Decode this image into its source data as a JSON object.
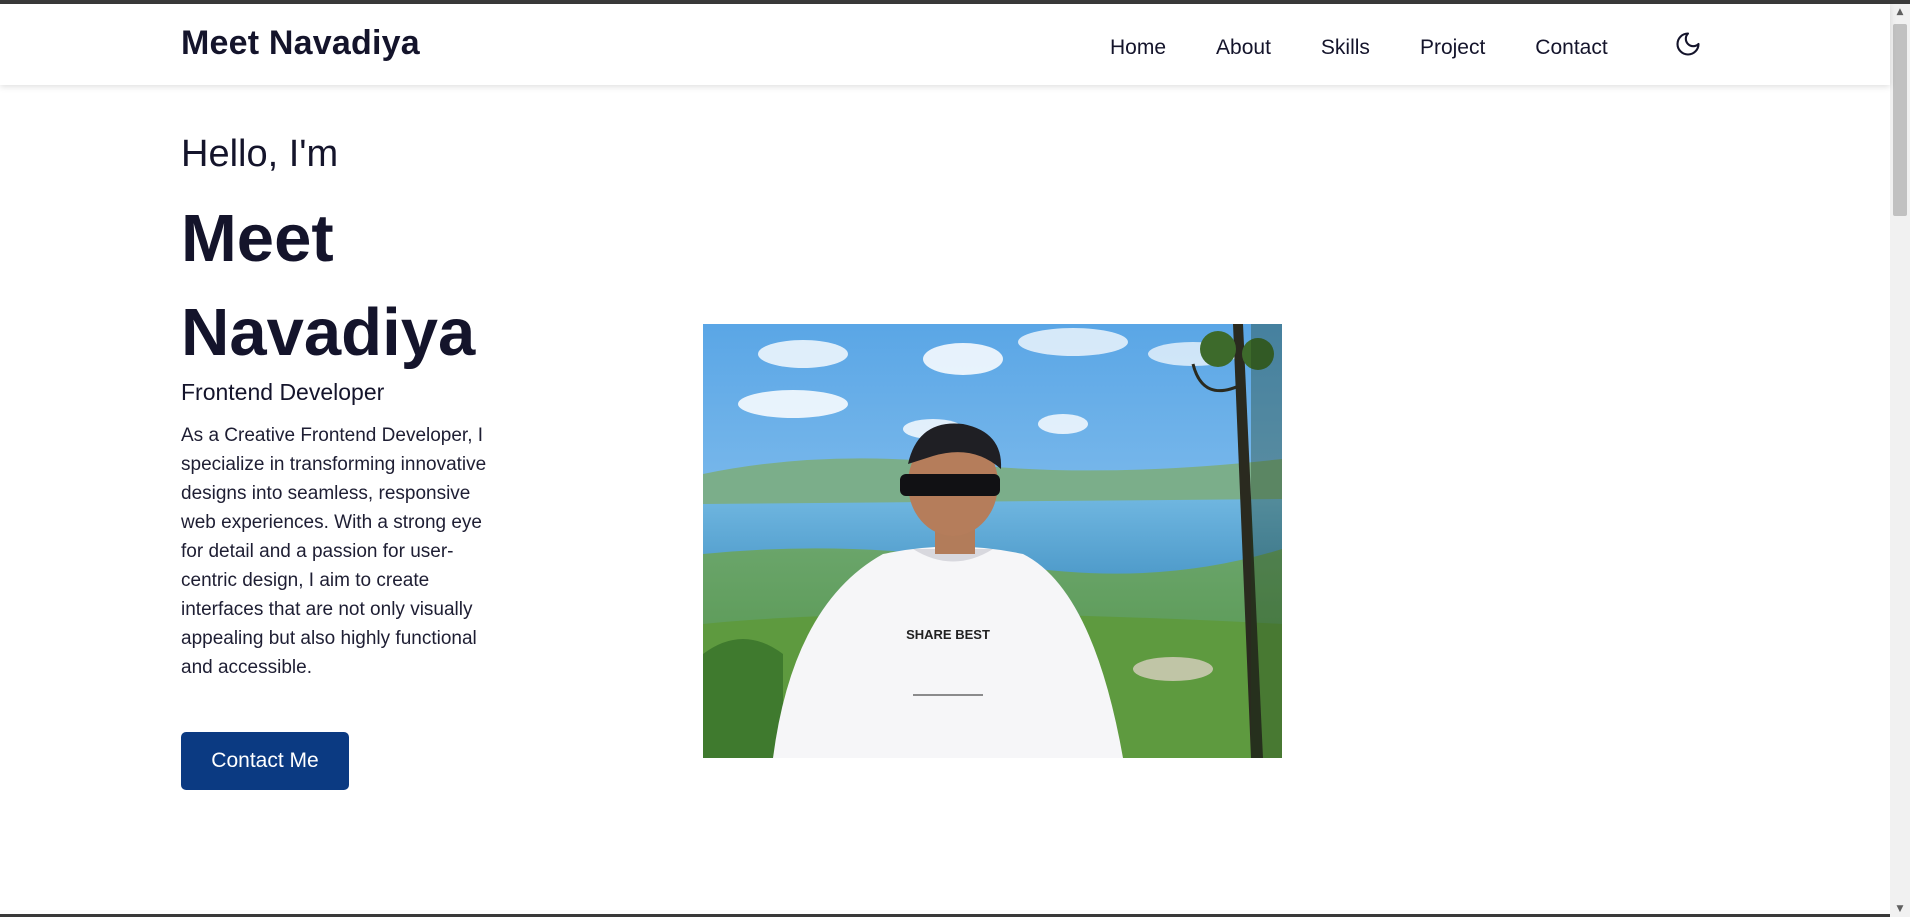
{
  "header": {
    "brand": "Meet Navadiya",
    "nav": [
      "Home",
      "About",
      "Skills",
      "Project",
      "Contact"
    ],
    "theme_icon": "moon-icon"
  },
  "hero": {
    "greeting": "Hello, I'm",
    "name": "Meet Navadiya",
    "role": "Frontend Developer",
    "bio": "As a Creative Frontend Developer, I specialize in transforming innovative designs into seamless, responsive web experiences. With a strong eye for detail and a passion for user-centric design, I aim to create interfaces that are not only visually appealing but also highly functional and accessible.",
    "cta": "Contact Me",
    "photo_shirt_text": "SHARE BEST"
  },
  "colors": {
    "text": "#14142b",
    "button": "#0b3a82",
    "button_text": "#ffffff"
  }
}
